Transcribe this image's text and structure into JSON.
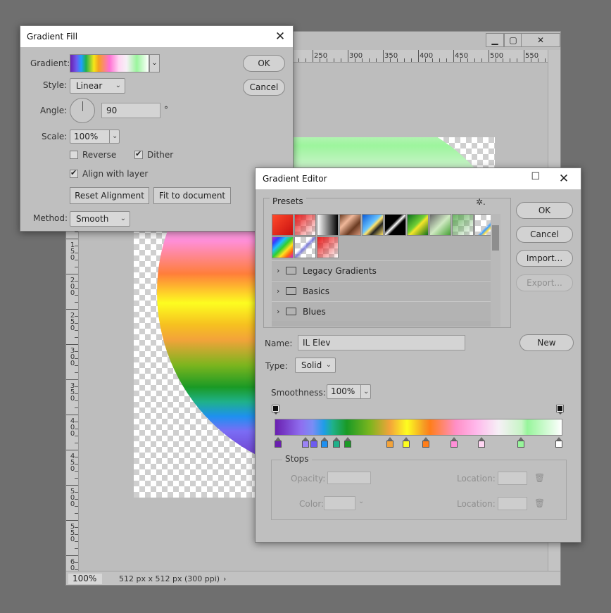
{
  "document": {
    "ruler_top_labels": [
      "250",
      "300",
      "350",
      "400",
      "450",
      "500",
      "550"
    ],
    "ruler_left_labels": [
      "1\n5\n0",
      "2\n0\n0",
      "2\n5\n0",
      "3\n0\n0",
      "3\n5\n0",
      "4\n0\n0",
      "4\n5\n0",
      "5\n0\n0",
      "5\n5\n0",
      "6\n0"
    ],
    "window_controls": {
      "minimize": "▁",
      "maximize": "▢",
      "close": "✕"
    },
    "status": {
      "zoom": "100%",
      "info": "512 px x 512 px (300 ppi)",
      "arrow": "›"
    }
  },
  "gradient_fill": {
    "title": "Gradient Fill",
    "close": "✕",
    "gradient_label": "Gradient:",
    "style_label": "Style:",
    "style_value": "Linear",
    "angle_label": "Angle:",
    "angle_value": "90",
    "angle_unit": "°",
    "scale_label": "Scale:",
    "scale_value": "100%",
    "reverse_label": "Reverse",
    "reverse_checked": false,
    "dither_label": "Dither",
    "dither_checked": true,
    "align_label": "Align with layer",
    "align_checked": true,
    "reset_alignment": "Reset Alignment",
    "fit_to_document": "Fit to document",
    "method_label": "Method:",
    "method_value": "Smooth",
    "ok": "OK",
    "cancel": "Cancel"
  },
  "gradient_editor": {
    "title": "Gradient Editor",
    "controls": {
      "maximize": "☐",
      "close": "✕"
    },
    "presets_label": "Presets",
    "gear": "✲.",
    "folders": [
      "Legacy Gradients",
      "Basics",
      "Blues"
    ],
    "ok": "OK",
    "cancel": "Cancel",
    "import": "Import...",
    "export": "Export...",
    "name_label": "Name:",
    "name_value": "IL Elev",
    "new": "New",
    "type_label": "Type:",
    "type_value": "Solid",
    "smoothness_label": "Smoothness:",
    "smoothness_value": "100%",
    "color_stops": [
      {
        "location": 0,
        "color": "#6a1fb0"
      },
      {
        "location": 9.8,
        "color": "#9b83f5"
      },
      {
        "location": 12.8,
        "color": "#6d5cf0"
      },
      {
        "location": 16.6,
        "color": "#1e90f0"
      },
      {
        "location": 20.8,
        "color": "#1fb18a"
      },
      {
        "location": 24.8,
        "color": "#1a9a25"
      },
      {
        "location": 39.8,
        "color": "#f3a33a"
      },
      {
        "location": 45.7,
        "color": "#fdfd20"
      },
      {
        "location": 52.6,
        "color": "#ff7e1a"
      },
      {
        "location": 62.6,
        "color": "#ff8fd8"
      },
      {
        "location": 72.5,
        "color": "#ffd6f3"
      },
      {
        "location": 86.5,
        "color": "#97f59b"
      },
      {
        "location": 100,
        "color": "#ffffff"
      }
    ],
    "stops_label": "Stops",
    "opacity_label": "Opacity:",
    "location_label": "Location:",
    "color_label": "Color:",
    "location2_label": "Location:",
    "trash": "🗑"
  }
}
